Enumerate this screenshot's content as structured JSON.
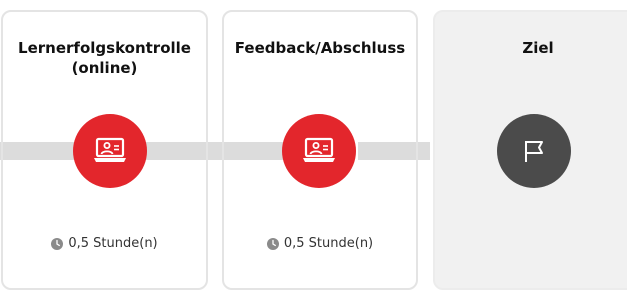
{
  "steps": [
    {
      "title": "Lernerfolgskontrolle\n(online)",
      "duration": "0,5 Stunde(n)",
      "icon": "online-training-icon"
    },
    {
      "title": "Feedback/Abschluss",
      "duration": "0,5 Stunde(n)",
      "icon": "online-training-icon"
    }
  ],
  "goal": {
    "title": "Ziel",
    "icon": "flag-icon"
  },
  "colors": {
    "accent": "#e3262c",
    "goal_node": "#4b4b4b",
    "track": "#dcdcdc",
    "card_border": "#e4e4e4",
    "goal_card_bg": "#f1f1f1"
  }
}
